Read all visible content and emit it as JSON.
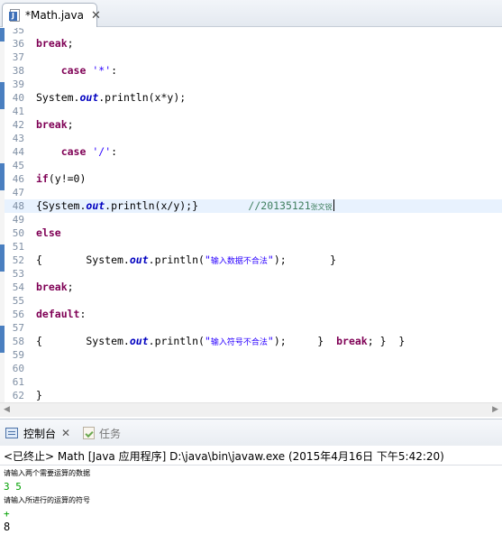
{
  "editor": {
    "tab": {
      "title": "*Math.java"
    },
    "lines": [
      {
        "n": "35",
        "segments": []
      },
      {
        "n": "36",
        "segments": [
          {
            "t": "break",
            "c": "kw"
          },
          {
            "t": ";"
          }
        ]
      },
      {
        "n": "37",
        "segments": []
      },
      {
        "n": "38",
        "segments": [
          {
            "t": "    "
          },
          {
            "t": "case",
            "c": "kw"
          },
          {
            "t": " "
          },
          {
            "t": "'*'",
            "c": "str"
          },
          {
            "t": ":"
          }
        ]
      },
      {
        "n": "39",
        "segments": []
      },
      {
        "n": "40",
        "segments": [
          {
            "t": "System."
          },
          {
            "t": "out",
            "c": "fld"
          },
          {
            "t": ".println(x*y);"
          }
        ]
      },
      {
        "n": "41",
        "segments": []
      },
      {
        "n": "42",
        "segments": [
          {
            "t": "break",
            "c": "kw"
          },
          {
            "t": ";"
          }
        ]
      },
      {
        "n": "43",
        "segments": []
      },
      {
        "n": "44",
        "segments": [
          {
            "t": "    "
          },
          {
            "t": "case",
            "c": "kw"
          },
          {
            "t": " "
          },
          {
            "t": "'/'",
            "c": "str"
          },
          {
            "t": ":"
          }
        ]
      },
      {
        "n": "45",
        "segments": []
      },
      {
        "n": "46",
        "segments": [
          {
            "t": "if",
            "c": "kw"
          },
          {
            "t": "(y!=0)"
          }
        ]
      },
      {
        "n": "47",
        "segments": []
      },
      {
        "n": "48",
        "current": true,
        "segments": [
          {
            "t": "{System."
          },
          {
            "t": "out",
            "c": "fld"
          },
          {
            "t": ".println(x/y);}        "
          },
          {
            "t": "//20135121",
            "c": "cmt"
          },
          {
            "t": "张文锐",
            "c": "cmt-small"
          },
          {
            "t": "",
            "c": "caret"
          }
        ]
      },
      {
        "n": "49",
        "segments": []
      },
      {
        "n": "50",
        "segments": [
          {
            "t": "else",
            "c": "kw"
          }
        ]
      },
      {
        "n": "51",
        "segments": []
      },
      {
        "n": "52",
        "segments": [
          {
            "t": "{       System."
          },
          {
            "t": "out",
            "c": "fld"
          },
          {
            "t": ".println("
          },
          {
            "t": "\"",
            "c": "str"
          },
          {
            "t": "输入数据不合法",
            "c": "str str-small"
          },
          {
            "t": "\"",
            "c": "str"
          },
          {
            "t": ");       }"
          }
        ]
      },
      {
        "n": "53",
        "segments": []
      },
      {
        "n": "54",
        "segments": [
          {
            "t": "break",
            "c": "kw"
          },
          {
            "t": ";"
          }
        ]
      },
      {
        "n": "55",
        "segments": []
      },
      {
        "n": "56",
        "segments": [
          {
            "t": "default",
            "c": "kw"
          },
          {
            "t": ":"
          }
        ]
      },
      {
        "n": "57",
        "segments": []
      },
      {
        "n": "58",
        "segments": [
          {
            "t": "{       System."
          },
          {
            "t": "out",
            "c": "fld"
          },
          {
            "t": ".println("
          },
          {
            "t": "\"",
            "c": "str"
          },
          {
            "t": "输入符号不合法",
            "c": "str str-small"
          },
          {
            "t": "\"",
            "c": "str"
          },
          {
            "t": ");     }  "
          },
          {
            "t": "break",
            "c": "kw"
          },
          {
            "t": "; }  }"
          }
        ]
      },
      {
        "n": "59",
        "segments": []
      },
      {
        "n": "60",
        "segments": []
      },
      {
        "n": "61",
        "segments": []
      },
      {
        "n": "62",
        "segments": [
          {
            "t": "}"
          }
        ]
      }
    ]
  },
  "console": {
    "tabs": {
      "console_label": "控制台",
      "tasks_label": "任务"
    },
    "status": "<已终止> Math [Java 应用程序] D:\\java\\bin\\javaw.exe (2015年4月16日 下午5:42:20)",
    "output": [
      {
        "text": "请输入两个需要运算的数据",
        "kind": "out-small"
      },
      {
        "text": "3 5",
        "kind": "input"
      },
      {
        "text": "请输入所进行的运算的符号",
        "kind": "out-small"
      },
      {
        "text": "+",
        "kind": "input"
      },
      {
        "text": "8",
        "kind": "out"
      }
    ]
  },
  "colors": {
    "keyword": "#7f0055",
    "field": "#0000c0",
    "string": "#2a00ff",
    "comment": "#3f7f5f",
    "console_input": "#00a000",
    "current_line": "#e8f2fe"
  },
  "icons": [
    "java-file-icon",
    "close-icon",
    "console-icon",
    "tasks-icon"
  ]
}
